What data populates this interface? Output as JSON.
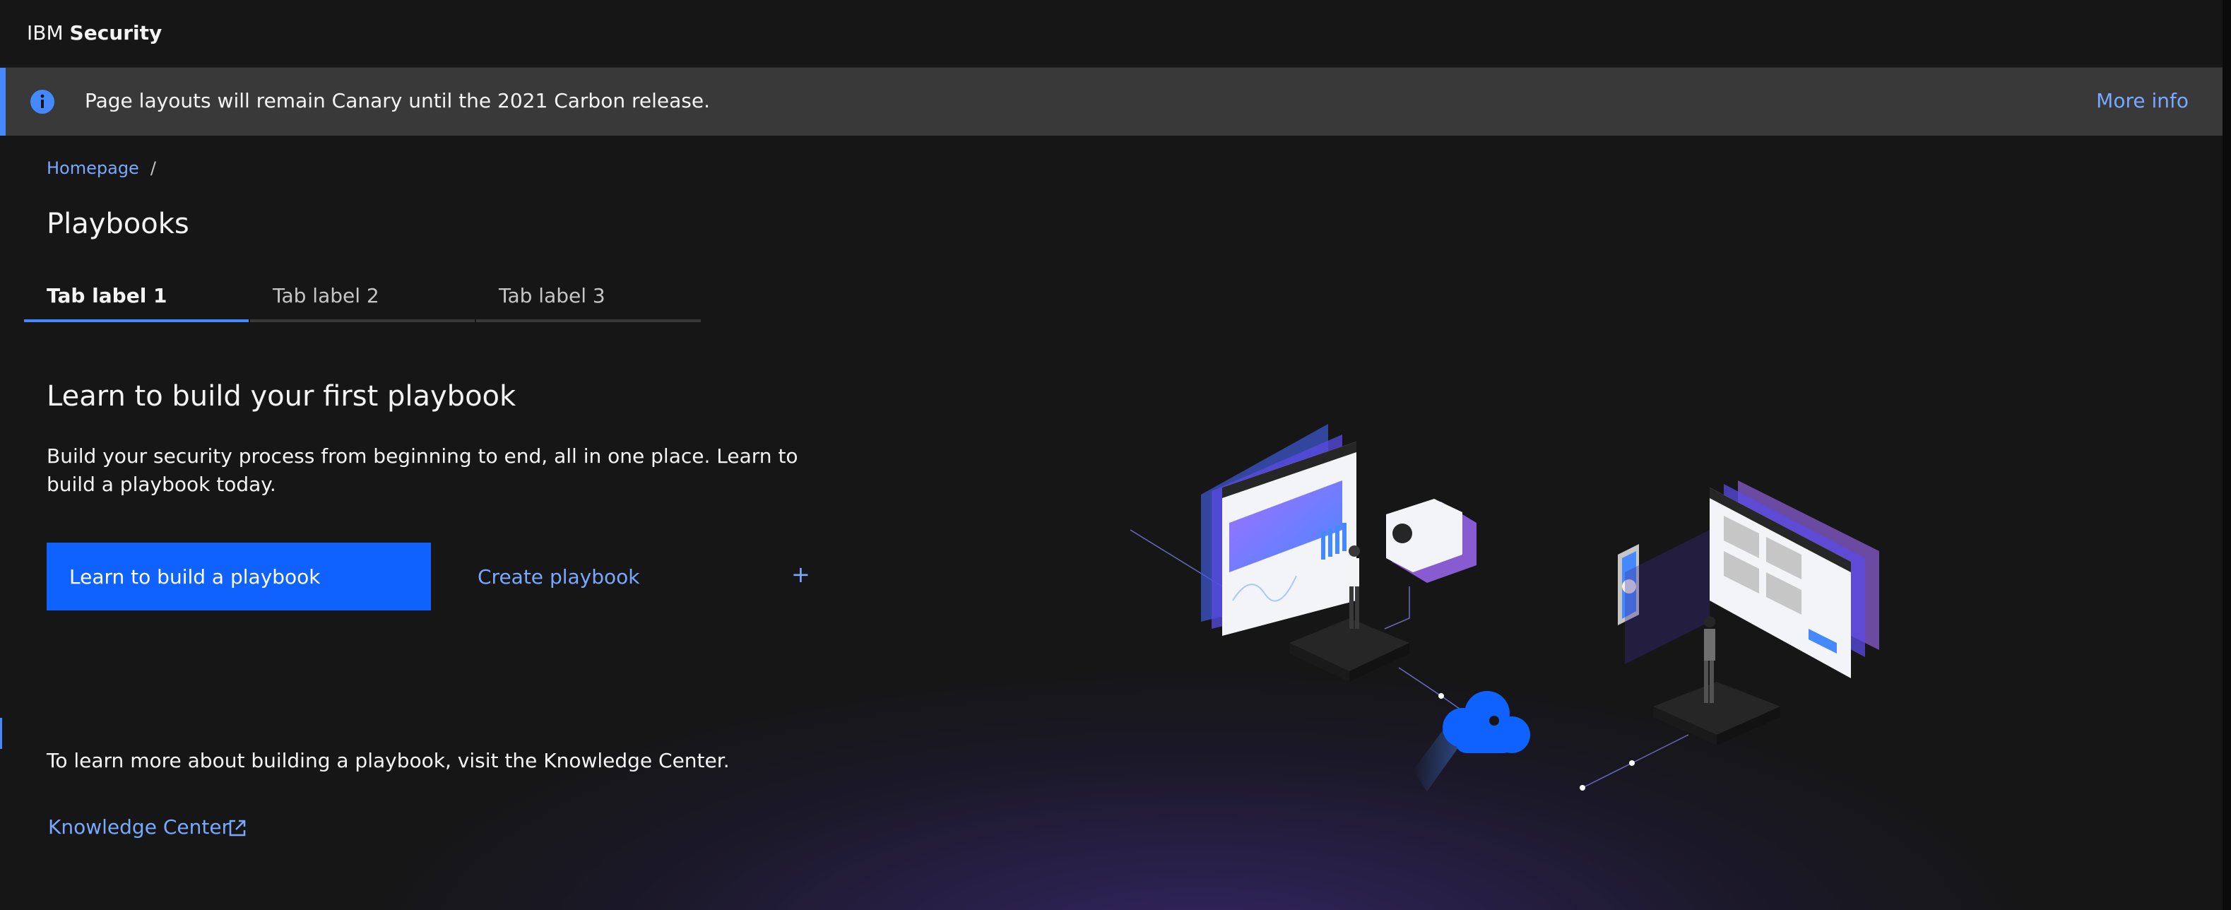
{
  "header": {
    "brand_prefix": "IBM",
    "brand_name": "Security"
  },
  "notification": {
    "text": "Page layouts will remain Canary until the 2021 Carbon release.",
    "action": "More info",
    "icon": "info-icon",
    "accent": "#4589ff"
  },
  "breadcrumb": {
    "items": [
      "Homepage"
    ],
    "separator": "/"
  },
  "page": {
    "title": "Playbooks"
  },
  "tabs": [
    {
      "label": "Tab label 1",
      "active": true
    },
    {
      "label": "Tab label 2",
      "active": false
    },
    {
      "label": "Tab label 3",
      "active": false
    }
  ],
  "content": {
    "heading": "Learn to build your first playbook",
    "description": "Build your security process from beginning to end, all in one place. Learn to build a playbook today.",
    "primary_button": "Learn to build a playbook",
    "secondary_button": "Create playbook",
    "secondary_icon": "plus-icon",
    "footnote": "To learn more about building a playbook, visit the Knowledge Center.",
    "link": "Knowledge Center",
    "link_icon": "launch-icon"
  },
  "colors": {
    "background": "#161616",
    "primary": "#0f62fe",
    "link": "#78a9ff",
    "notification_bg": "#393939"
  }
}
